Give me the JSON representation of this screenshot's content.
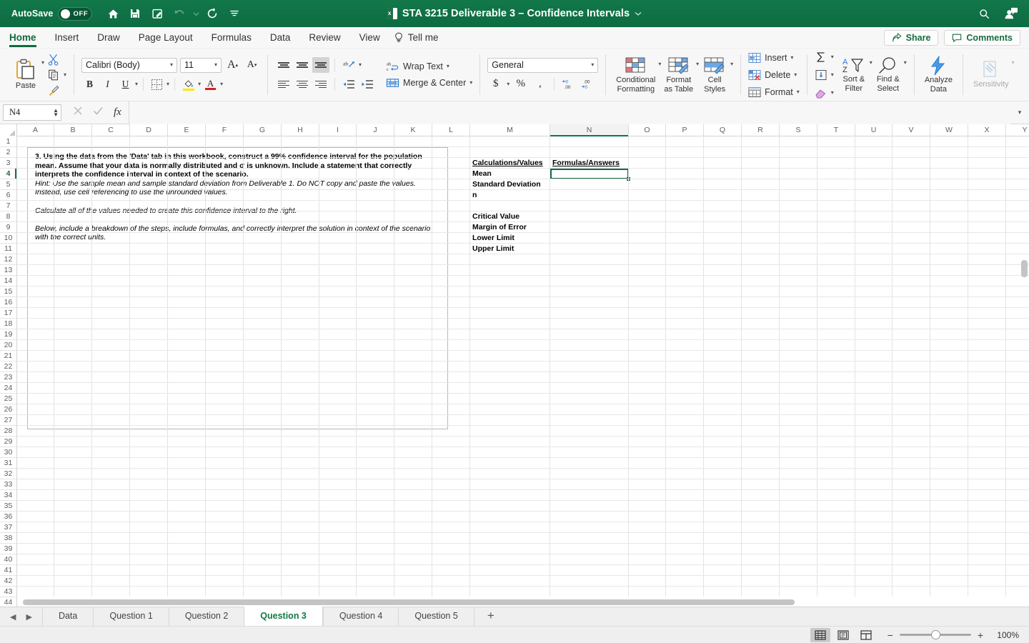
{
  "titlebar": {
    "autosave_label": "AutoSave",
    "autosave_state": "OFF",
    "document_title": "STA 3215 Deliverable 3 – Confidence Intervals",
    "quick_access": [
      "home-icon",
      "save-icon",
      "file-edit-icon",
      "undo-icon",
      "undo-dropdown-icon",
      "redo-icon",
      "customize-qat-icon"
    ],
    "right_icons": [
      "search-icon",
      "account-icon"
    ],
    "accent_color": "#12784a"
  },
  "ribbon": {
    "tabs": [
      {
        "label": "Home",
        "active": true
      },
      {
        "label": "Insert",
        "active": false
      },
      {
        "label": "Draw",
        "active": false
      },
      {
        "label": "Page Layout",
        "active": false
      },
      {
        "label": "Formulas",
        "active": false
      },
      {
        "label": "Data",
        "active": false
      },
      {
        "label": "Review",
        "active": false
      },
      {
        "label": "View",
        "active": false
      }
    ],
    "tell_me": "Tell me",
    "share_label": "Share",
    "comments_label": "Comments",
    "clipboard": {
      "paste_label": "Paste"
    },
    "font": {
      "family_value": "Calibri (Body)",
      "size_value": "11",
      "grow_label": "A",
      "shrink_label": "A",
      "bold": "B",
      "italic": "I",
      "underline": "U"
    },
    "alignment": {
      "wrap_text_label": "Wrap Text",
      "merge_center_label": "Merge & Center"
    },
    "number": {
      "format_value": "General",
      "currency": "$",
      "percent": "%",
      "comma": "‚"
    },
    "styles": {
      "conditional_formatting": "Conditional\nFormatting",
      "conditional_formatting_l1": "Conditional",
      "conditional_formatting_l2": "Formatting",
      "format_as_table_l1": "Format",
      "format_as_table_l2": "as Table",
      "cell_styles_l1": "Cell",
      "cell_styles_l2": "Styles"
    },
    "cells": {
      "insert_label": "Insert",
      "delete_label": "Delete",
      "format_label": "Format"
    },
    "editing": {
      "sort_filter_l1": "Sort &",
      "sort_filter_l2": "Filter",
      "find_select_l1": "Find &",
      "find_select_l2": "Select"
    },
    "analysis": {
      "analyze_data_l1": "Analyze",
      "analyze_data_l2": "Data",
      "sensitivity_label": "Sensitivity"
    }
  },
  "formula_bar": {
    "name_box_value": "N4",
    "formula_value": "",
    "cancel_icon": "close-icon",
    "confirm_icon": "check-icon",
    "function_icon": "fx-icon"
  },
  "grid": {
    "columns": [
      "A",
      "B",
      "C",
      "D",
      "E",
      "F",
      "G",
      "H",
      "I",
      "J",
      "K",
      "L",
      "M",
      "N",
      "O",
      "P",
      "Q",
      "R",
      "S",
      "T",
      "U",
      "V",
      "W",
      "X",
      "Y"
    ],
    "selected_column": "N",
    "selected_row": 4,
    "rows": [
      1,
      2,
      3,
      4,
      5,
      6,
      7,
      8,
      9,
      10,
      11,
      12,
      13,
      14,
      15,
      16,
      17,
      18,
      19,
      20,
      21,
      22,
      23,
      24,
      25,
      26,
      27,
      28,
      29,
      30,
      31,
      32,
      33,
      34,
      35,
      36,
      37,
      38,
      39,
      40,
      41,
      42,
      43,
      44
    ],
    "textbox_paragraphs": [
      {
        "text": "3. Using the data from the 'Data' tab in this workbook, construct a 99% confidence interval for the population mean. Assume that your data is normally distributed and σ is unknown. Include a statement that correctly interprets the confidence interval in context of the scenario.",
        "style": "bold"
      },
      {
        "text": "Hint: Use the sample mean and sample standard deviation from Deliverable 1. Do NOT copy and paste the values. Instead, use cell referencing to use the unrounded values.",
        "style": "italic"
      },
      {
        "text": "",
        "style": "spacer"
      },
      {
        "text": "Calculate all of the values needed to create this confidence interval to the right.",
        "style": "italic"
      },
      {
        "text": "",
        "style": "spacer"
      },
      {
        "text": "Below, include a breakdown of the steps, include formulas, and correctly interpret the solution in context of the scenario with the correct units.",
        "style": "italic"
      }
    ],
    "cells": [
      {
        "ref": "M3",
        "text": "Calculations/Values",
        "row": 3,
        "col": "M",
        "underline": true
      },
      {
        "ref": "N3",
        "text": "Formulas/Answers",
        "row": 3,
        "col": "N",
        "underline": true
      },
      {
        "ref": "M4",
        "text": "Mean",
        "row": 4,
        "col": "M",
        "underline": false
      },
      {
        "ref": "M5",
        "text": "Standard Deviation",
        "row": 5,
        "col": "M",
        "underline": false
      },
      {
        "ref": "M6",
        "text": "n",
        "row": 6,
        "col": "M",
        "underline": false
      },
      {
        "ref": "M8",
        "text": "Critical Value",
        "row": 8,
        "col": "M",
        "underline": false
      },
      {
        "ref": "M9",
        "text": "Margin of Error",
        "row": 9,
        "col": "M",
        "underline": false
      },
      {
        "ref": "M10",
        "text": "Lower Limit",
        "row": 10,
        "col": "M",
        "underline": false
      },
      {
        "ref": "M11",
        "text": "Upper Limit",
        "row": 11,
        "col": "M",
        "underline": false
      }
    ]
  },
  "sheet_tabs": {
    "prev_icon": "prev-sheet-icon",
    "next_icon": "next-sheet-icon",
    "tabs": [
      {
        "label": "Data",
        "active": false
      },
      {
        "label": "Question 1",
        "active": false
      },
      {
        "label": "Question 2",
        "active": false
      },
      {
        "label": "Question 3",
        "active": true
      },
      {
        "label": "Question 4",
        "active": false
      },
      {
        "label": "Question 5",
        "active": false
      }
    ],
    "add_label": "+"
  },
  "status_bar": {
    "views": [
      "normal-view-icon",
      "page-layout-icon",
      "page-break-icon"
    ],
    "active_view": "normal-view-icon",
    "zoom_out": "−",
    "zoom_in": "+",
    "zoom_level": "100%"
  }
}
